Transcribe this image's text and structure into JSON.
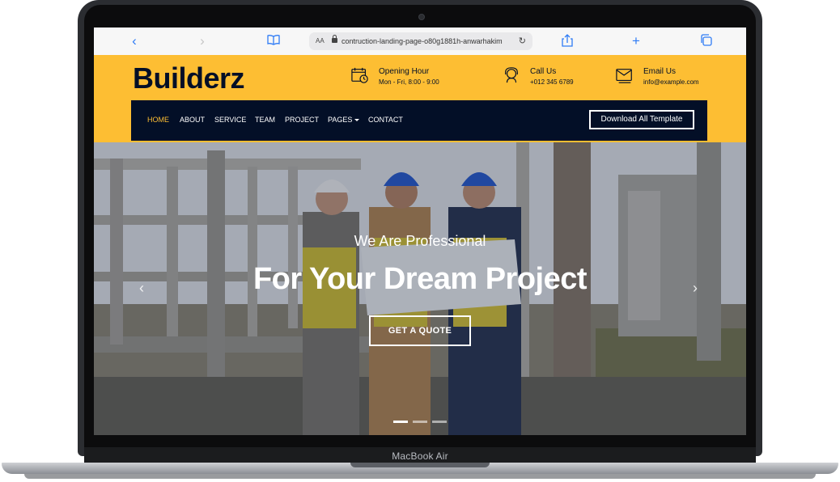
{
  "device": {
    "brand_label": "MacBook Air"
  },
  "browser": {
    "text_size_label": "AA",
    "url": "contruction-landing-page-o80g1881h-anwarhakim",
    "icons": [
      "back-icon",
      "forward-icon",
      "reader-icon",
      "lock-icon",
      "reload-icon",
      "share-icon",
      "new-tab-icon",
      "tabs-icon"
    ]
  },
  "header": {
    "logo": "Builderz",
    "opening": {
      "title": "Opening Hour",
      "detail": "Mon - Fri, 8:00 - 9:00"
    },
    "call": {
      "title": "Call Us",
      "detail": "+012 345 6789"
    },
    "email": {
      "title": "Email Us",
      "detail": "info@example.com"
    }
  },
  "nav": {
    "items": [
      "HOME",
      "ABOUT",
      "SERVICE",
      "TEAM",
      "PROJECT",
      "PAGES",
      "CONTACT"
    ],
    "active": "HOME",
    "download_label": "Download All Template"
  },
  "hero": {
    "subtitle": "We Are Professional",
    "title": "For Your Dream Project",
    "cta_label": "GET A QUOTE",
    "slides_count": 3,
    "active_slide": 1
  },
  "colors": {
    "accent": "#fdbe33",
    "navy": "#030f27",
    "browser_blue": "#2f7cf6"
  }
}
